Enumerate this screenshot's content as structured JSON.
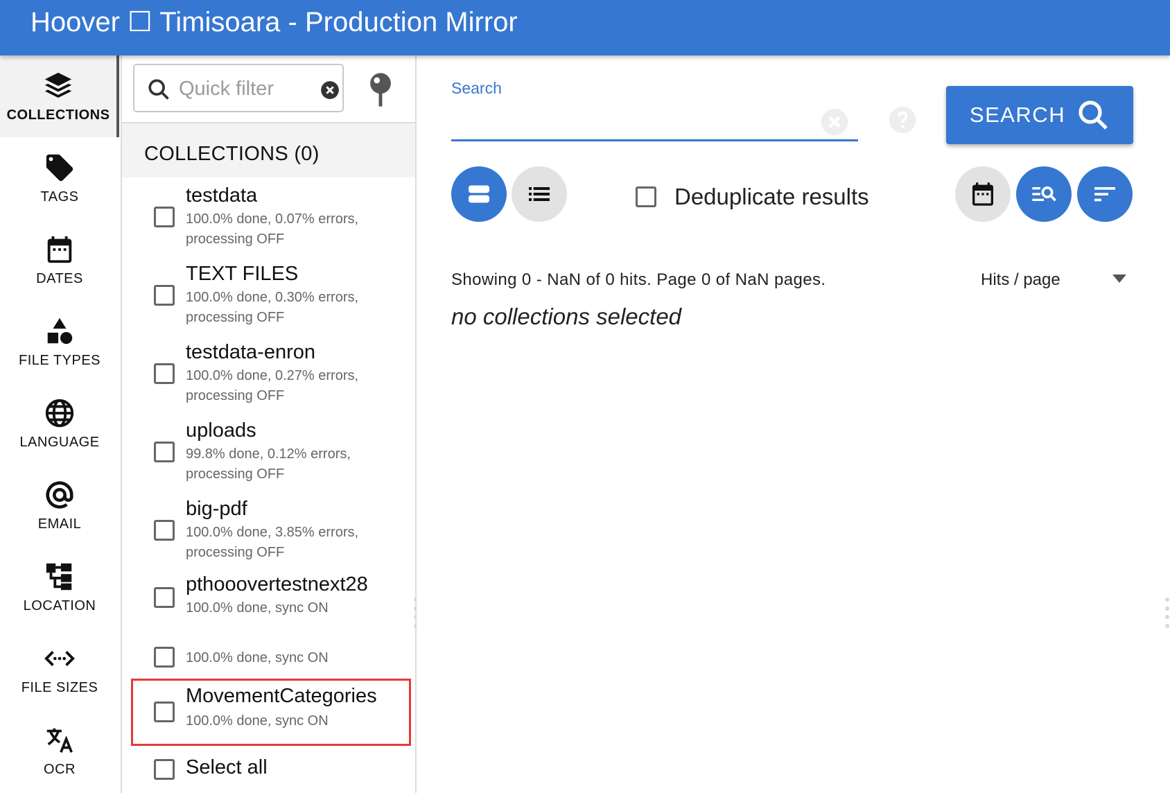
{
  "header": {
    "title": "Hoover ☐ Timisoara - Production Mirror"
  },
  "rail": {
    "items": [
      {
        "label": "COLLECTIONS",
        "icon": "layers-icon"
      },
      {
        "label": "TAGS",
        "icon": "tag-icon"
      },
      {
        "label": "DATES",
        "icon": "calendar-icon"
      },
      {
        "label": "FILE TYPES",
        "icon": "shapes-icon"
      },
      {
        "label": "LANGUAGE",
        "icon": "globe-icon"
      },
      {
        "label": "EMAIL",
        "icon": "at-sign-icon"
      },
      {
        "label": "LOCATION",
        "icon": "folder-tree-icon"
      },
      {
        "label": "FILE SIZES",
        "icon": "size-arrows-icon"
      },
      {
        "label": "OCR",
        "icon": "translate-icon"
      }
    ]
  },
  "panel": {
    "filter_placeholder": "Quick filter",
    "heading": "COLLECTIONS (0)",
    "collections": [
      {
        "name": "testdata",
        "status": "100.0% done, 0.07% errors, processing OFF"
      },
      {
        "name": "TEXT FILES",
        "status": "100.0% done, 0.30% errors, processing OFF"
      },
      {
        "name": "testdata-enron",
        "status": "100.0% done, 0.27% errors, processing OFF"
      },
      {
        "name": "uploads",
        "status": "99.8% done, 0.12% errors, processing OFF"
      },
      {
        "name": "big-pdf",
        "status": "100.0% done, 3.85% errors, processing OFF"
      },
      {
        "name": "pthooovertestnext28",
        "status": "100.0% done, sync ON"
      },
      {
        "name": "",
        "status": "100.0% done, sync ON"
      },
      {
        "name": "MovementCategories",
        "status": "100.0% done, sync ON"
      }
    ],
    "select_all": "Select all"
  },
  "search": {
    "label": "Search",
    "value": "",
    "button_label": "SEARCH",
    "dedup_label": "Deduplicate results",
    "showing_text": "Showing 0 - NaN of 0 hits. Page 0 of NaN pages.",
    "hits_per_page_label": "Hits / page",
    "empty_message": "no collections selected"
  },
  "colors": {
    "accent": "#3677d1",
    "highlight": "#e53935",
    "active_rail_bg": "#f2f2f2"
  }
}
